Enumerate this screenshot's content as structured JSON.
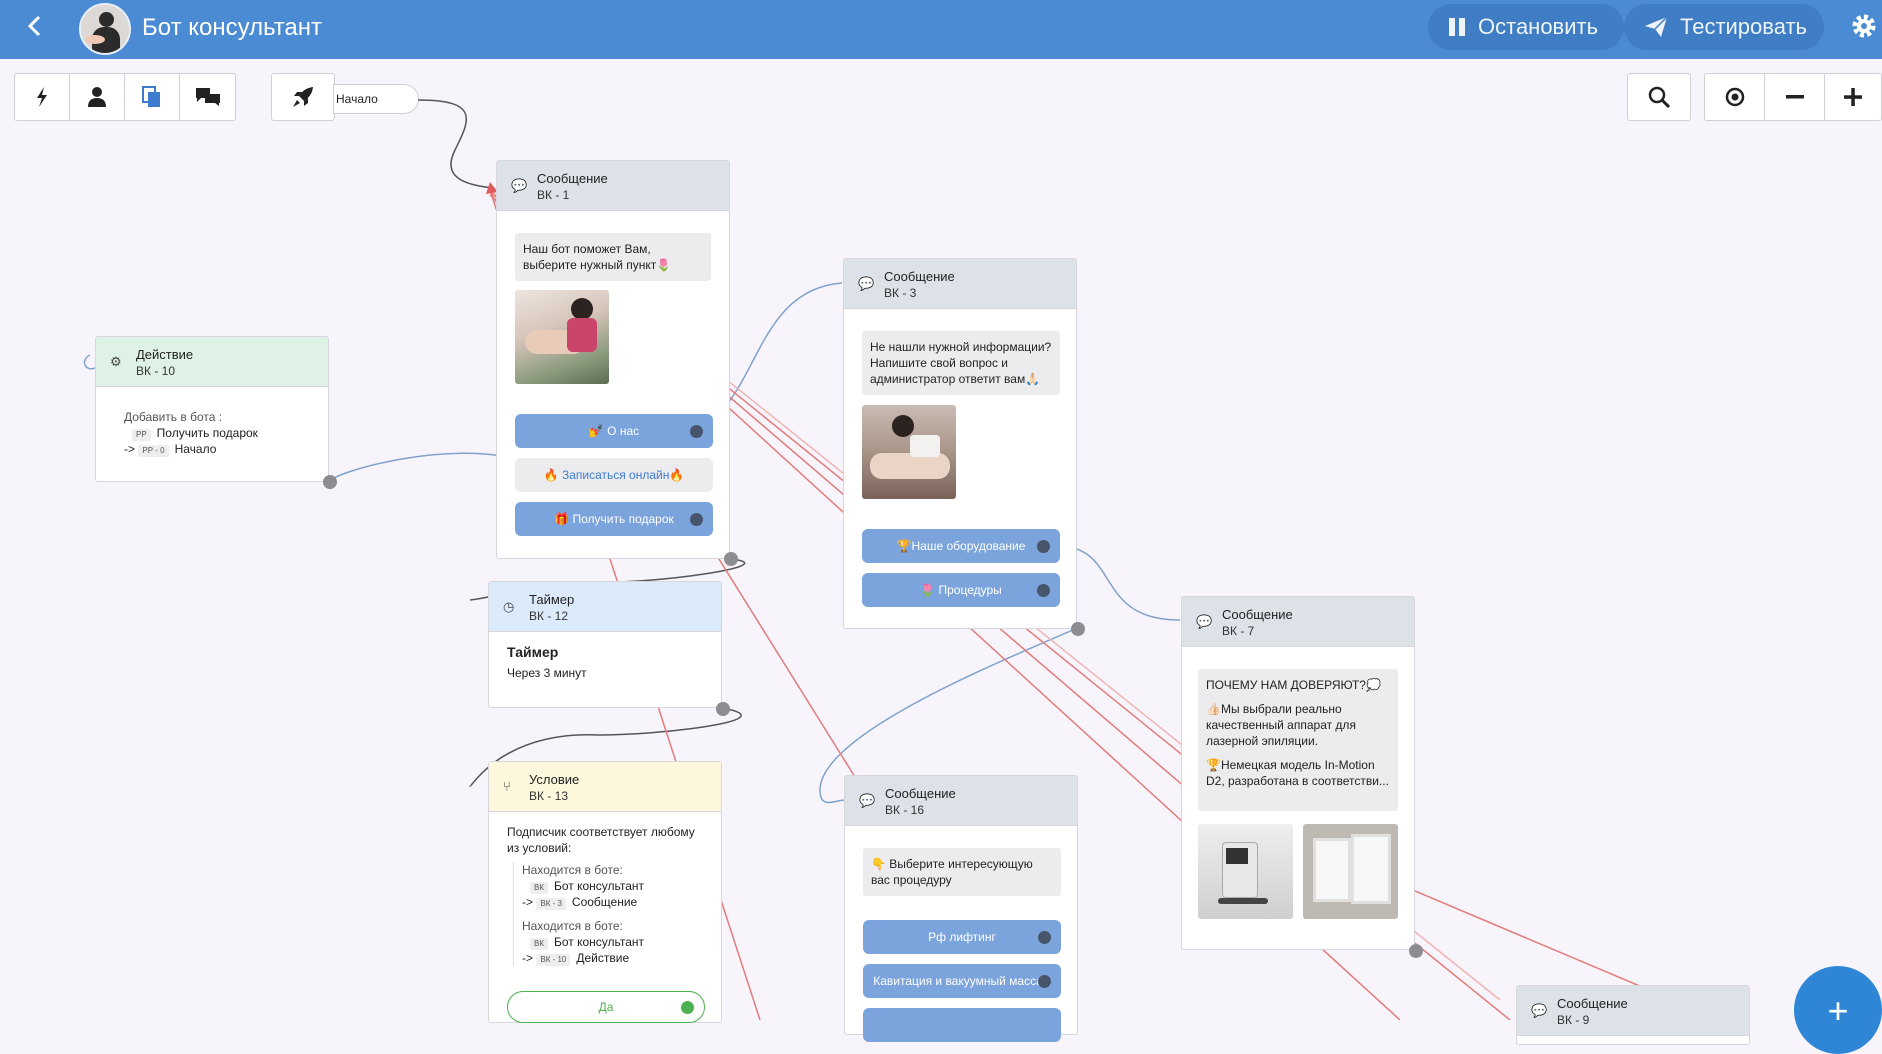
{
  "header": {
    "back_icon": "chevron-left-icon",
    "title": "Бот консультант",
    "stop_label": "Остановить",
    "test_label": "Тестировать",
    "settings_icon": "gear-icon",
    "color": "#4a8bd3"
  },
  "toolbar": {
    "tools": [
      "bolt-icon",
      "user-icon",
      "copy-icon",
      "chat-icon",
      "rocket-icon"
    ],
    "start_label": "Начало",
    "right_tools": [
      "search-icon",
      "target-icon",
      "minus-icon",
      "plus-icon"
    ]
  },
  "nodes": {
    "msg1": {
      "title": "Сообщение",
      "sub": "ВК - 1",
      "text": "Наш бот поможет Вам, выберите нужный пункт🌷",
      "buttons": [
        "💅 О нас",
        "🔥 Записаться онлайн🔥",
        "🎁 Получить подарок"
      ]
    },
    "action10": {
      "title": "Действие",
      "sub": "ВК - 10",
      "label": "Добавить в бота :",
      "tag1": "РР",
      "line1": "Получить подарок",
      "arrow": "->",
      "tag2": "РР - 0",
      "line2": "Начало"
    },
    "msg3": {
      "title": "Сообщение",
      "sub": "ВК - 3",
      "text": "Не нашли нужной информации? Напишите свой вопрос и администратор ответит вам🙏🏻",
      "buttons": [
        "🏆Наше оборудование",
        "🌷 Процедуры"
      ]
    },
    "timer12": {
      "title": "Таймер",
      "sub": "ВК - 12",
      "heading": "Таймер",
      "text": "Через 3 минут"
    },
    "cond13": {
      "title": "Условие",
      "sub": "ВК - 13",
      "text": "Подписчик соответствует любому из условий:",
      "c1_label": "Находится в боте:",
      "c1_tag1": "ВК",
      "c1_bot": "Бот консультант",
      "c1_arrow": "->",
      "c1_tag2": "ВК - 3",
      "c1_node": "Сообщение",
      "c2_label": "Находится в боте:",
      "c2_tag1": "ВК",
      "c2_bot": "Бот консультант",
      "c2_arrow": "->",
      "c2_tag2": "ВК - 10",
      "c2_node": "Действие",
      "yes": "Да"
    },
    "msg16": {
      "title": "Сообщение",
      "sub": "ВК - 16",
      "text": "👇 Выберите интересующую вас процедуру",
      "buttons": [
        "Рф лифтинг",
        "Кавитация и вакуумный массаж"
      ]
    },
    "msg7": {
      "title": "Сообщение",
      "sub": "ВК - 7",
      "p1": "ПОЧЕМУ НАМ ДОВЕРЯЮТ?💭",
      "p2": "👍🏻Мы выбрали реально качественный аппарат для лазерной эпиляции.",
      "p3": "🏆Немецкая модель In-Motion D2, разработана в соответстви..."
    },
    "msg9": {
      "title": "Сообщение",
      "sub": "ВК - 9"
    }
  },
  "fab_label": "+"
}
